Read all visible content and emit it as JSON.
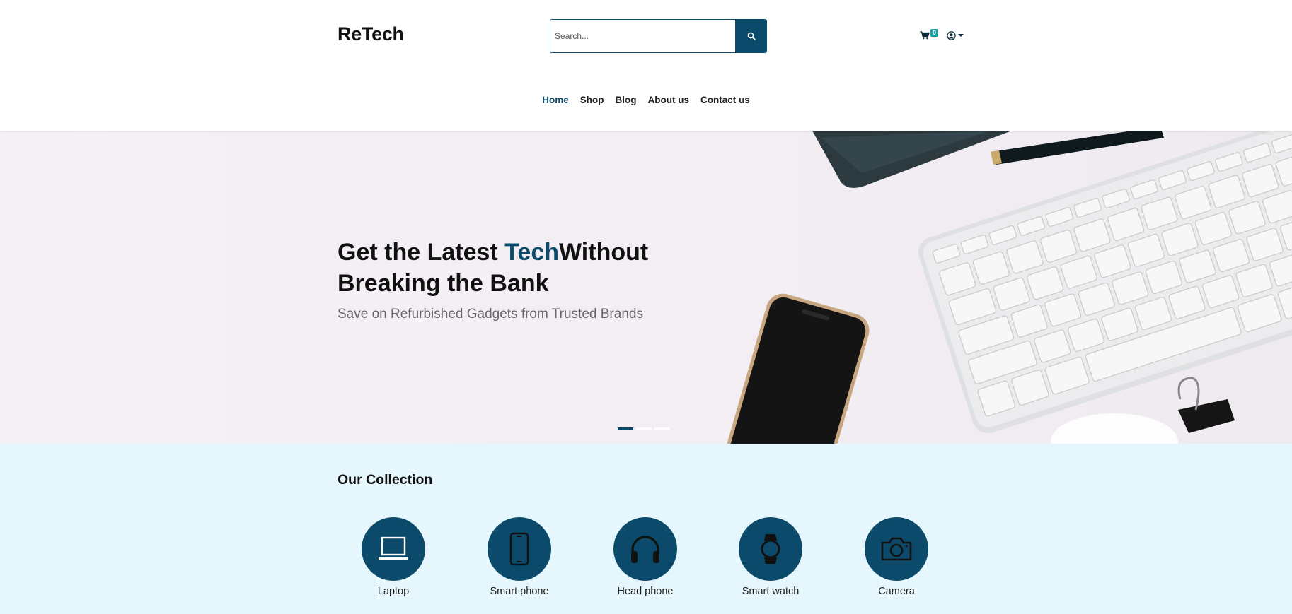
{
  "header": {
    "logo": "ReTech",
    "search": {
      "placeholder": "Search..."
    },
    "cart_count": "0",
    "nav": [
      {
        "label": "Home",
        "active": true
      },
      {
        "label": "Shop"
      },
      {
        "label": "Blog"
      },
      {
        "label": "About us"
      },
      {
        "label": "Contact us"
      }
    ]
  },
  "hero": {
    "title_part1": "Get the Latest ",
    "title_accent": "Tech",
    "title_part2": "Without Breaking the Bank",
    "subtitle": "Save on Refurbished Gadgets from Trusted Brands",
    "slide_count": 3,
    "active_slide": 1
  },
  "collection": {
    "title": "Our Collection",
    "items": [
      {
        "label": "Laptop",
        "icon": "laptop-icon"
      },
      {
        "label": "Smart phone",
        "icon": "smartphone-icon"
      },
      {
        "label": "Head phone",
        "icon": "headphones-icon"
      },
      {
        "label": "Smart watch",
        "icon": "smartwatch-icon"
      },
      {
        "label": "Camera",
        "icon": "camera-icon"
      }
    ]
  },
  "colors": {
    "primary": "#0b4a6a",
    "badge": "#15a1a6",
    "collection_bg": "#e5f6fc"
  }
}
